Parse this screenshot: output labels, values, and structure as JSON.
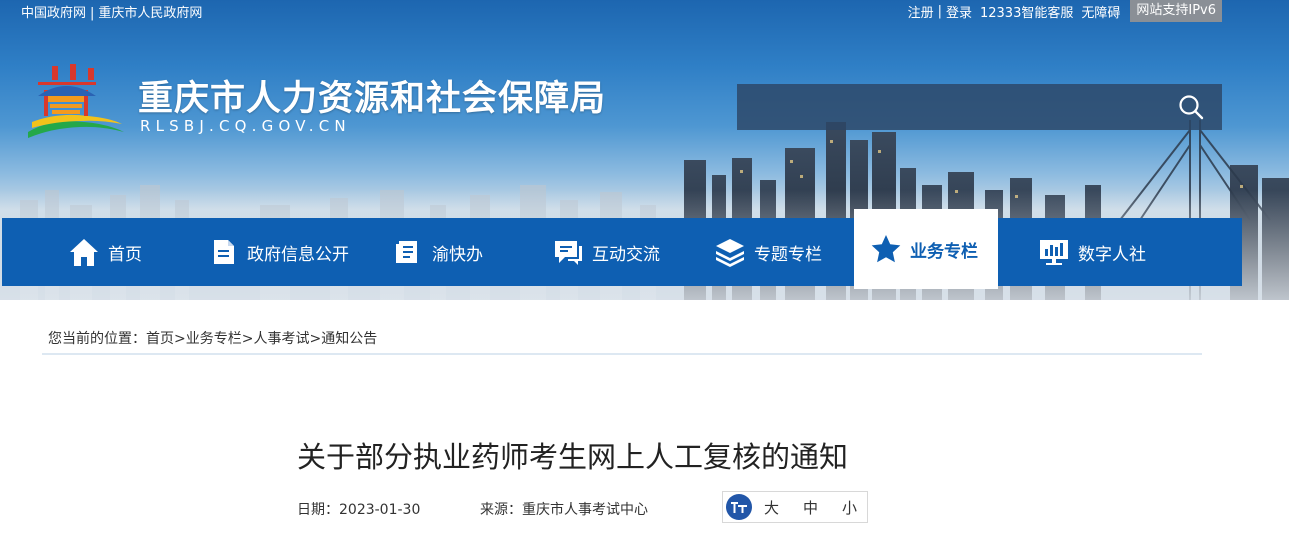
{
  "top_bar": {
    "left_links": [
      "中国政府网",
      "重庆市人民政府网"
    ],
    "left_separator": "|",
    "register": "注册",
    "login": "登录",
    "separator": "|",
    "service": "12333智能客服",
    "accessibility": "无障碍",
    "ipv6": "网站支持IPv6"
  },
  "header": {
    "site_title": "重庆市人力资源和社会保障局",
    "site_domain": "RLSBJ.CQ.GOV.CN",
    "search_placeholder": ""
  },
  "nav": {
    "items": [
      {
        "label": "首页",
        "icon": "home-icon",
        "active": false
      },
      {
        "label": "政府信息公开",
        "icon": "document-icon",
        "active": false
      },
      {
        "label": "渝快办",
        "icon": "book-icon",
        "active": false
      },
      {
        "label": "互动交流",
        "icon": "chat-icon",
        "active": false
      },
      {
        "label": "专题专栏",
        "icon": "layers-icon",
        "active": false
      },
      {
        "label": "业务专栏",
        "icon": "star-icon",
        "active": true
      },
      {
        "label": "数字人社",
        "icon": "chart-monitor-icon",
        "active": false
      }
    ]
  },
  "breadcrumb": {
    "prefix": "您当前的位置：",
    "separator": ">",
    "items": [
      "首页",
      "业务专栏",
      "人事考试",
      "通知公告"
    ]
  },
  "article": {
    "title": "关于部分执业药师考生网上人工复核的通知",
    "date_text": "日期：2023-01-30",
    "source_text": "来源：重庆市人事考试中心",
    "font_sizes": [
      "大",
      "中",
      "小"
    ]
  },
  "colors": {
    "nav_bg": "#0e5fb2",
    "nav_active_bg": "#ffffff",
    "nav_active_text": "#0e5fb2",
    "ipv6_bg": "#8a8f96",
    "fontsize_icon_bg": "#2256a8"
  }
}
